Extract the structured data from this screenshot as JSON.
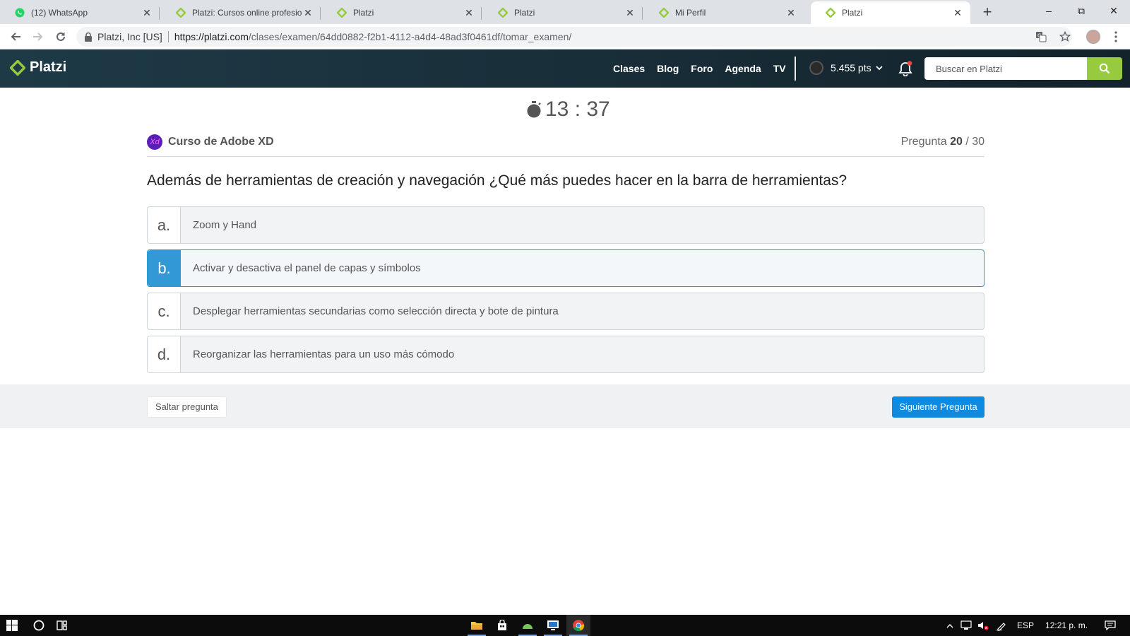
{
  "browser": {
    "tabs": [
      {
        "title": "(12) WhatsApp",
        "icon": "whatsapp-icon"
      },
      {
        "title": "Platzi: Cursos online profesiona",
        "icon": "platzi-icon"
      },
      {
        "title": "Platzi",
        "icon": "platzi-icon"
      },
      {
        "title": "Platzi",
        "icon": "platzi-icon"
      },
      {
        "title": "Mi Perfil",
        "icon": "platzi-icon"
      },
      {
        "title": "Platzi",
        "icon": "platzi-icon",
        "active": true
      }
    ],
    "address": {
      "org": "Platzi, Inc [US]",
      "host": "https://platzi.com",
      "path": "/clases/examen/64dd0882-f2b1-4112-a4d4-48ad3f0461df/tomar_examen/"
    }
  },
  "header": {
    "logo": "Platzi",
    "nav": [
      "Clases",
      "Blog",
      "Foro",
      "Agenda",
      "TV"
    ],
    "points": "5.455 pts",
    "search_placeholder": "Buscar en Platzi"
  },
  "exam": {
    "timer": "13 : 37",
    "course_badge": "Xd",
    "course_name": "Curso de Adobe XD",
    "counter_prefix": "Pregunta",
    "counter_current": "20",
    "counter_total": "/ 30",
    "question": "Además de herramientas de creación y navegación ¿Qué más puedes hacer en la barra de herramientas?",
    "options": [
      {
        "letter": "a.",
        "text": "Zoom y Hand"
      },
      {
        "letter": "b.",
        "text": "Activar y desactiva el panel de capas y símbolos",
        "selected": true
      },
      {
        "letter": "c.",
        "text": "Desplegar herramientas secundarias como selección directa y bote de pintura"
      },
      {
        "letter": "d.",
        "text": "Reorganizar las herramientas para un uso más cómodo"
      }
    ],
    "skip_label": "Saltar pregunta",
    "next_label": "Siguiente Pregunta"
  },
  "taskbar": {
    "language": "ESP",
    "time": "12:21 p. m."
  },
  "colors": {
    "platzi_green": "#98ca3f",
    "header_bg": "#1c3643",
    "selected_blue": "#3399d6",
    "next_button": "#0e8ae0"
  }
}
